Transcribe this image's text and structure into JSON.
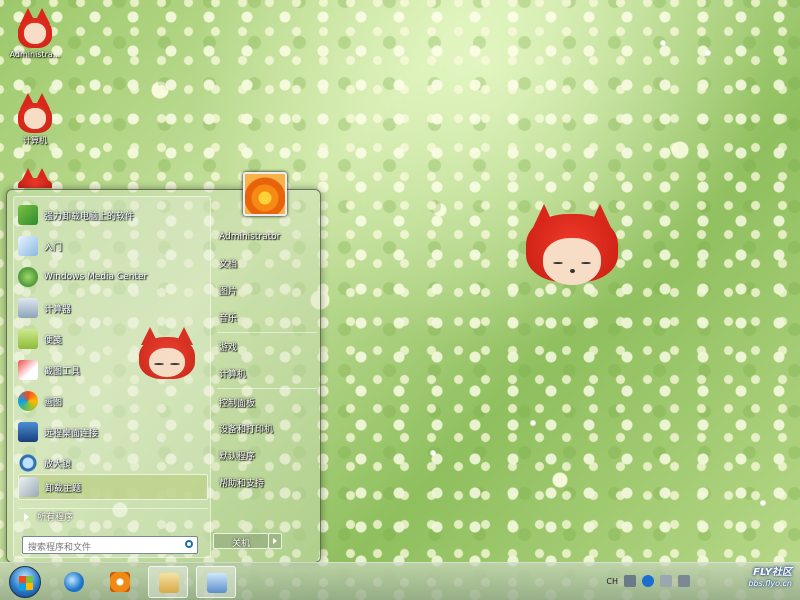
{
  "desktop": {
    "icons": [
      {
        "label": "Administra..."
      },
      {
        "label": "计算机"
      },
      {
        "label": ""
      }
    ]
  },
  "start_menu": {
    "programs": [
      {
        "label": "强力卸载电脑上的软件",
        "icon": "uninstall-icon"
      },
      {
        "label": "入门",
        "icon": "getting-started-icon"
      },
      {
        "label": "Windows Media Center",
        "icon": "media-center-icon"
      },
      {
        "label": "计算器",
        "icon": "calculator-icon"
      },
      {
        "label": "便笺",
        "icon": "sticky-notes-icon"
      },
      {
        "label": "截图工具",
        "icon": "snipping-tool-icon"
      },
      {
        "label": "画图",
        "icon": "paint-icon"
      },
      {
        "label": "远程桌面连接",
        "icon": "remote-desktop-icon"
      },
      {
        "label": "放大镜",
        "icon": "magnifier-icon"
      },
      {
        "label": "卸载主题",
        "icon": "uninstall-theme-icon"
      }
    ],
    "all_programs": "所有程序",
    "search_placeholder": "搜索程序和文件",
    "right_items": [
      "Administrator",
      "文档",
      "图片",
      "音乐",
      "游戏",
      "计算机",
      "控制面板",
      "设备和打印机",
      "默认程序",
      "帮助和支持"
    ],
    "shutdown_label": "关机"
  },
  "taskbar": {
    "tray_lang": "CH",
    "watermark_title": "FLY社区",
    "watermark_url": "bbs.flyo.cn"
  },
  "colors": {
    "accent": "#e8630a",
    "fox_red": "#d9271a"
  }
}
